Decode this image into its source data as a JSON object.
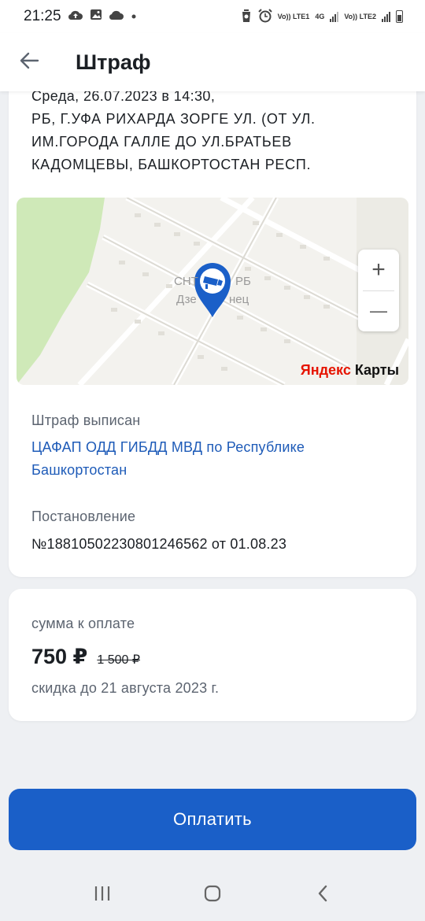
{
  "status_bar": {
    "time": "21:25",
    "left_icons": [
      "cloud-upload-icon",
      "image-icon",
      "cloud-icon",
      "dot-icon"
    ],
    "right_icons": [
      "recycle-icon",
      "alarm-icon",
      "volte1-icon",
      "signal1-icon",
      "volte2-icon",
      "signal2-icon",
      "battery-icon"
    ],
    "volte1": "Vo)) LTE1",
    "net": "4G",
    "volte2": "Vo)) LTE2"
  },
  "header": {
    "title": "Штраф",
    "back_icon": "arrow-left-icon"
  },
  "fine": {
    "datetime": "Среда, 26.07.2023 в 14:30,",
    "address": "РБ, Г.УФА РИХАРДА ЗОРГЕ УЛ. (ОТ УЛ. ИМ.ГОРОДА ГАЛЛЕ ДО УЛ.БРАТЬЕВ КАДОМЦЕВЫ, БАШКОРТОСТАН РЕСП.",
    "map": {
      "label_1": "СНТ",
      "label_2": "РБ",
      "label_3": "Дзе",
      "label_4": "нец",
      "zoom_in": "+",
      "zoom_out": "—",
      "brand_y": "Яндекс",
      "brand_rest": " Карты",
      "marker_icon": "camera-marker-icon",
      "colors": {
        "marker": "#1a5fc8",
        "park": "#cfe9b8",
        "road": "#ffffff"
      }
    },
    "issued_label": "Штраф выписан",
    "issued_by": "ЦАФАП ОДД ГИБДД МВД по Республике Башкортостан",
    "decree_label": "Постановление",
    "decree_value": "№18810502230801246562 от 01.08.23"
  },
  "payment": {
    "amount_label": "сумма к оплате",
    "amount": "750 ₽",
    "old_amount": "1 500 ₽",
    "discount_note": "скидка до 21 августа 2023 г.",
    "button_label": "Оплатить",
    "accent": "#1a5fc8"
  },
  "nav": {
    "recents_icon": "recents-icon",
    "home_icon": "home-icon",
    "back_icon": "nav-back-icon"
  }
}
